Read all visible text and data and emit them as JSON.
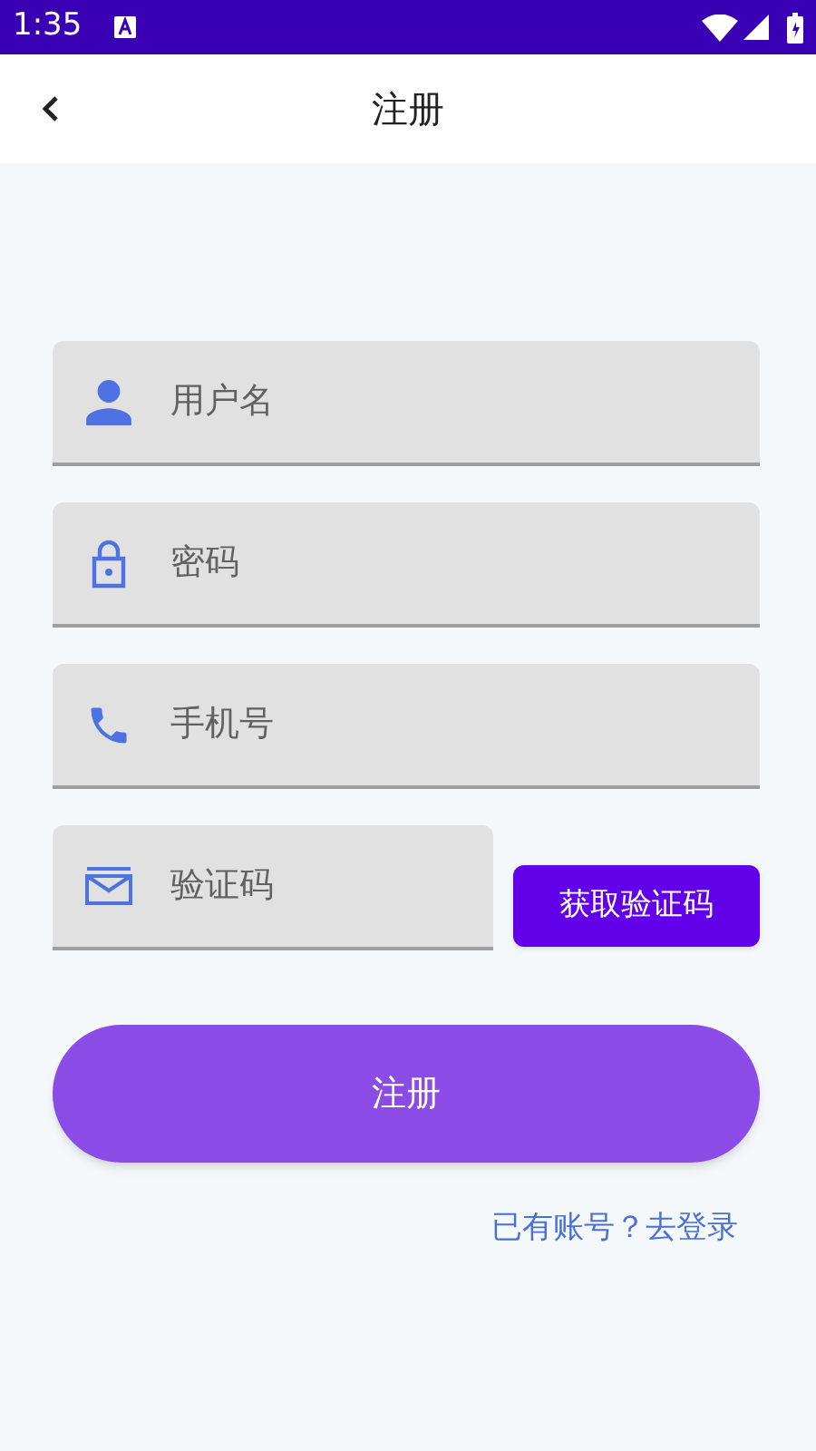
{
  "status_bar": {
    "time": "1:35"
  },
  "app_bar": {
    "title": "注册"
  },
  "fields": [
    {
      "kind": "user",
      "placeholder": "用户名"
    },
    {
      "kind": "lock",
      "placeholder": "密码"
    },
    {
      "kind": "phone",
      "placeholder": "手机号"
    }
  ],
  "code_field": {
    "kind": "mail",
    "placeholder": "验证码"
  },
  "code_button": "获取验证码",
  "submit_button": "注册",
  "login_link": "已有账号？去登录"
}
